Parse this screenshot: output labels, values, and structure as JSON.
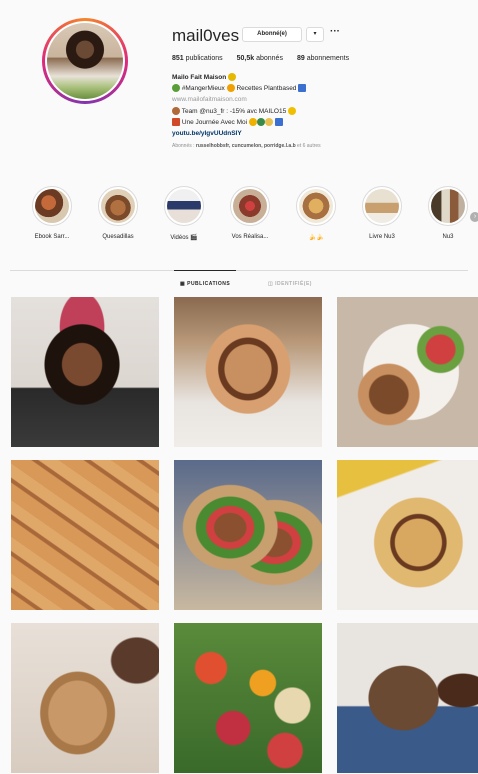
{
  "profile": {
    "username": "mail0ves",
    "follow_button": "Abonné(e)",
    "dropdown": "▾",
    "more": "···",
    "stats": {
      "publications": "851",
      "publications_label": "publications",
      "abonnes": "50,5k",
      "abonnes_label": "abonnés",
      "abonnements": "89",
      "abonnements_label": "abonnements"
    },
    "bio": {
      "name": "Mailo Fait Maison",
      "line1a": "#MangerMieux",
      "line1b": "Recettes Plantbased",
      "url": "www.mailofaitmaison.com",
      "line3": "Team @nu3_fr : -15% avc MAILO15",
      "line4": "Une Journée Avec Moi",
      "youtube": "youtu.be/yIgvUUdnSIY",
      "followers_prefix": "Abonnés : ",
      "followers_names": "russelhobbsfr, cuncumelon, porridge.l.a.b",
      "followers_suffix": " et 6 autres"
    }
  },
  "highlights": [
    {
      "label": "Ebook Sarr..."
    },
    {
      "label": "Quesadillas"
    },
    {
      "label": "Vidéos 🎬"
    },
    {
      "label": "Vos Réalisa..."
    },
    {
      "label": "🍌🍌"
    },
    {
      "label": "Livre Nu3"
    },
    {
      "label": "Nu3"
    }
  ],
  "highlight_next": "›",
  "tabs": {
    "publications": "▦  PUBLICATIONS",
    "identifie": "◫  IDENTIFIÉ(E)"
  },
  "colors": {
    "accent_link": "#003569",
    "border": "#dbdbdb"
  }
}
